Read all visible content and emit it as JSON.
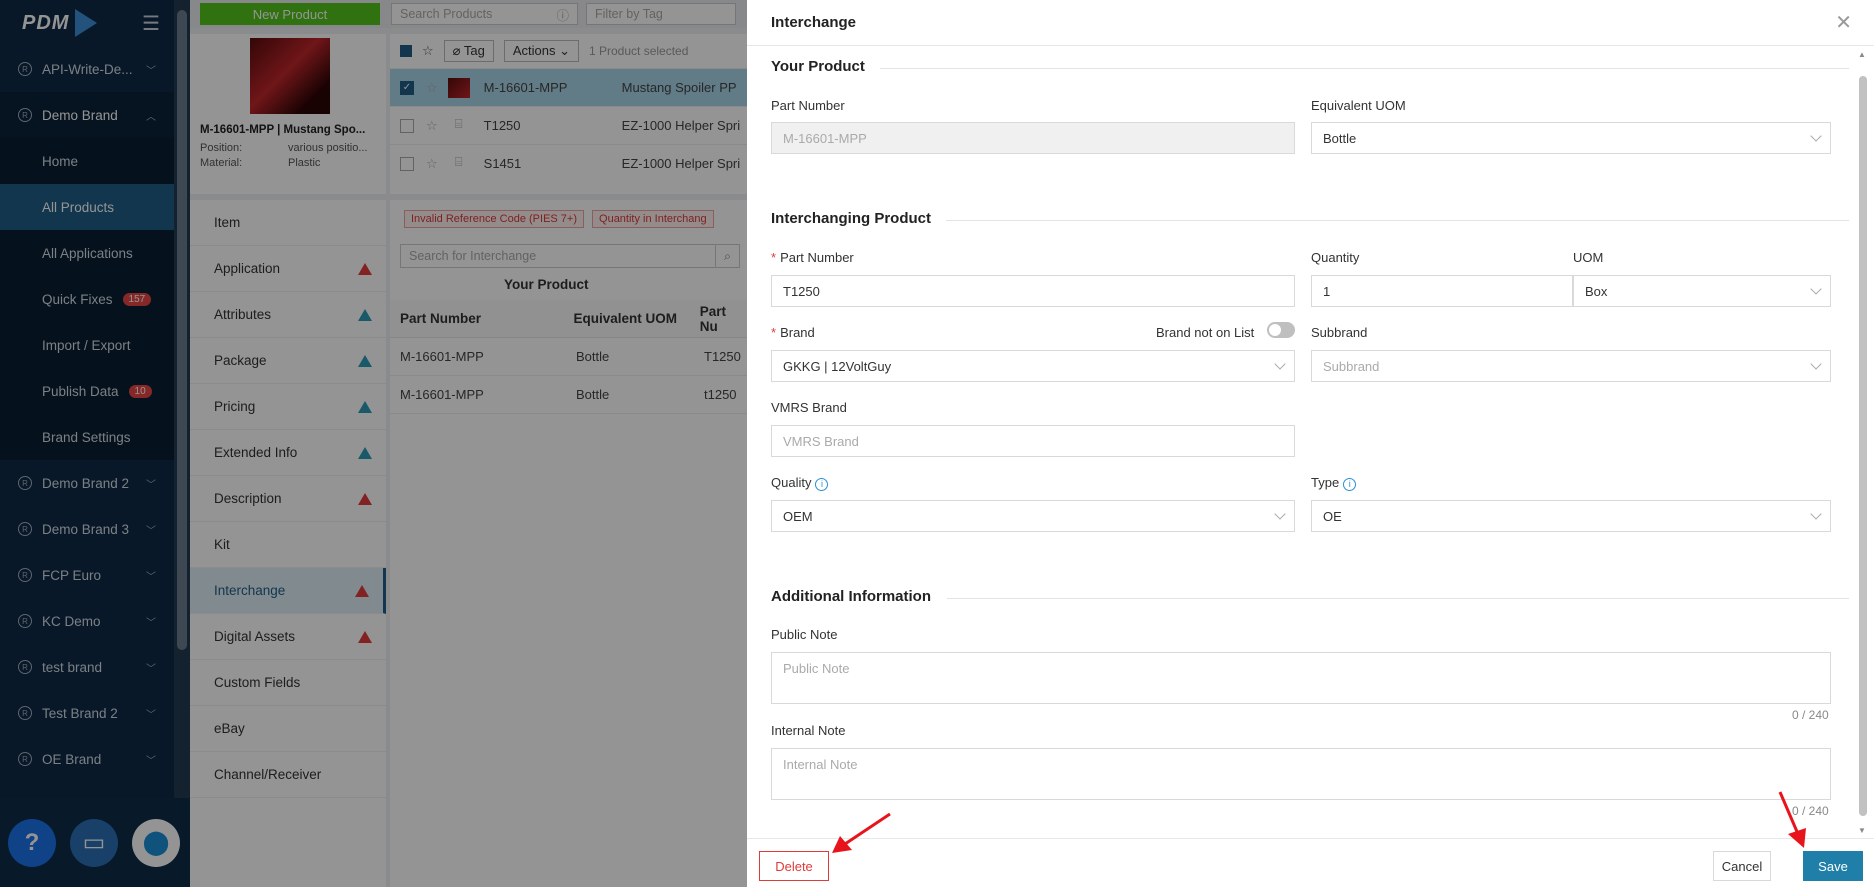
{
  "sidebar": {
    "logo": "PDM",
    "items": [
      {
        "label": "API-Write-De...",
        "type": "brand"
      },
      {
        "label": "Demo Brand",
        "type": "brand-open"
      },
      {
        "label": "Home",
        "type": "sub"
      },
      {
        "label": "All Products",
        "type": "sub-active"
      },
      {
        "label": "All Applications",
        "type": "sub"
      },
      {
        "label": "Quick Fixes",
        "type": "sub",
        "badge": "157"
      },
      {
        "label": "Import / Export",
        "type": "sub"
      },
      {
        "label": "Publish Data",
        "type": "sub",
        "badge": "10"
      },
      {
        "label": "Brand Settings",
        "type": "sub"
      },
      {
        "label": "Demo Brand 2",
        "type": "brand"
      },
      {
        "label": "Demo Brand 3",
        "type": "brand"
      },
      {
        "label": "FCP Euro",
        "type": "brand"
      },
      {
        "label": "KC Demo",
        "type": "brand"
      },
      {
        "label": "test brand",
        "type": "brand"
      },
      {
        "label": "Test Brand 2",
        "type": "brand"
      },
      {
        "label": "OE Brand",
        "type": "brand"
      }
    ],
    "help_label": "?"
  },
  "topbar": {
    "new_product": "New Product",
    "search_placeholder": "Search Products",
    "filter_placeholder": "Filter by Tag"
  },
  "product_card": {
    "title": "M-16601-MPP | Mustang Spo...",
    "fields": [
      {
        "key": "Position:",
        "value": "various positio..."
      },
      {
        "key": "Material:",
        "value": "Plastic"
      }
    ]
  },
  "list": {
    "tag_label": "Tag",
    "actions_label": "Actions",
    "selected_text": "1 Product selected",
    "rows": [
      {
        "part": "M-16601-MPP",
        "desc": "Mustang Spoiler PP",
        "selected": true
      },
      {
        "part": "T1250",
        "desc": "EZ-1000 Helper Spri",
        "selected": false
      },
      {
        "part": "S1451",
        "desc": "EZ-1000 Helper Spri",
        "selected": false
      }
    ]
  },
  "tabs": [
    {
      "label": "Item",
      "warn": ""
    },
    {
      "label": "Application",
      "warn": "red"
    },
    {
      "label": "Attributes",
      "warn": "teal"
    },
    {
      "label": "Package",
      "warn": "teal"
    },
    {
      "label": "Pricing",
      "warn": "teal"
    },
    {
      "label": "Extended Info",
      "warn": "teal"
    },
    {
      "label": "Description",
      "warn": "red"
    },
    {
      "label": "Kit",
      "warn": ""
    },
    {
      "label": "Interchange",
      "warn": "red",
      "active": true
    },
    {
      "label": "Digital Assets",
      "warn": "red"
    },
    {
      "label": "Custom Fields",
      "warn": ""
    },
    {
      "label": "eBay",
      "warn": ""
    },
    {
      "label": "Channel/Receiver",
      "warn": ""
    }
  ],
  "interchange_panel": {
    "error_tags": [
      "Invalid Reference Code (PIES 7+)",
      "Quantity in Interchang"
    ],
    "search_placeholder": "Search for Interchange",
    "group_header": "Your Product",
    "columns": [
      "Part Number",
      "Equivalent UOM",
      "Part Nu"
    ],
    "rows": [
      [
        "M-16601-MPP",
        "Bottle",
        "T1250"
      ],
      [
        "M-16601-MPP",
        "Bottle",
        "t1250"
      ]
    ]
  },
  "drawer": {
    "title": "Interchange",
    "your_product": {
      "section": "Your Product",
      "part_number_label": "Part Number",
      "part_number_value": "M-16601-MPP",
      "uom_label": "Equivalent UOM",
      "uom_value": "Bottle"
    },
    "interchanging": {
      "section": "Interchanging Product",
      "part_number_label": "Part Number",
      "part_number_value": "T1250",
      "quantity_label": "Quantity",
      "quantity_value": "1",
      "uom_label": "UOM",
      "uom_value": "Box",
      "brand_label": "Brand",
      "brand_not_on_list_label": "Brand not on List",
      "brand_value": "GKKG | 12VoltGuy",
      "subbrand_label": "Subbrand",
      "subbrand_placeholder": "Subbrand",
      "vmrs_label": "VMRS Brand",
      "vmrs_placeholder": "VMRS Brand",
      "quality_label": "Quality",
      "quality_value": "OEM",
      "type_label": "Type",
      "type_value": "OE"
    },
    "additional": {
      "section": "Additional Information",
      "public_note_label": "Public Note",
      "public_note_placeholder": "Public Note",
      "public_counter": "0 / 240",
      "internal_note_label": "Internal Note",
      "internal_note_placeholder": "Internal Note",
      "internal_counter": "0 / 240"
    },
    "footer": {
      "delete": "Delete",
      "cancel": "Cancel",
      "save": "Save"
    }
  },
  "colors": {
    "sidebar_bg": "#0e2a45",
    "active_item": "#1f5d86",
    "primary": "#1f7fa8",
    "danger": "#e03b3b",
    "success": "#52c41a",
    "annotation_arrow": "#e8141c"
  }
}
